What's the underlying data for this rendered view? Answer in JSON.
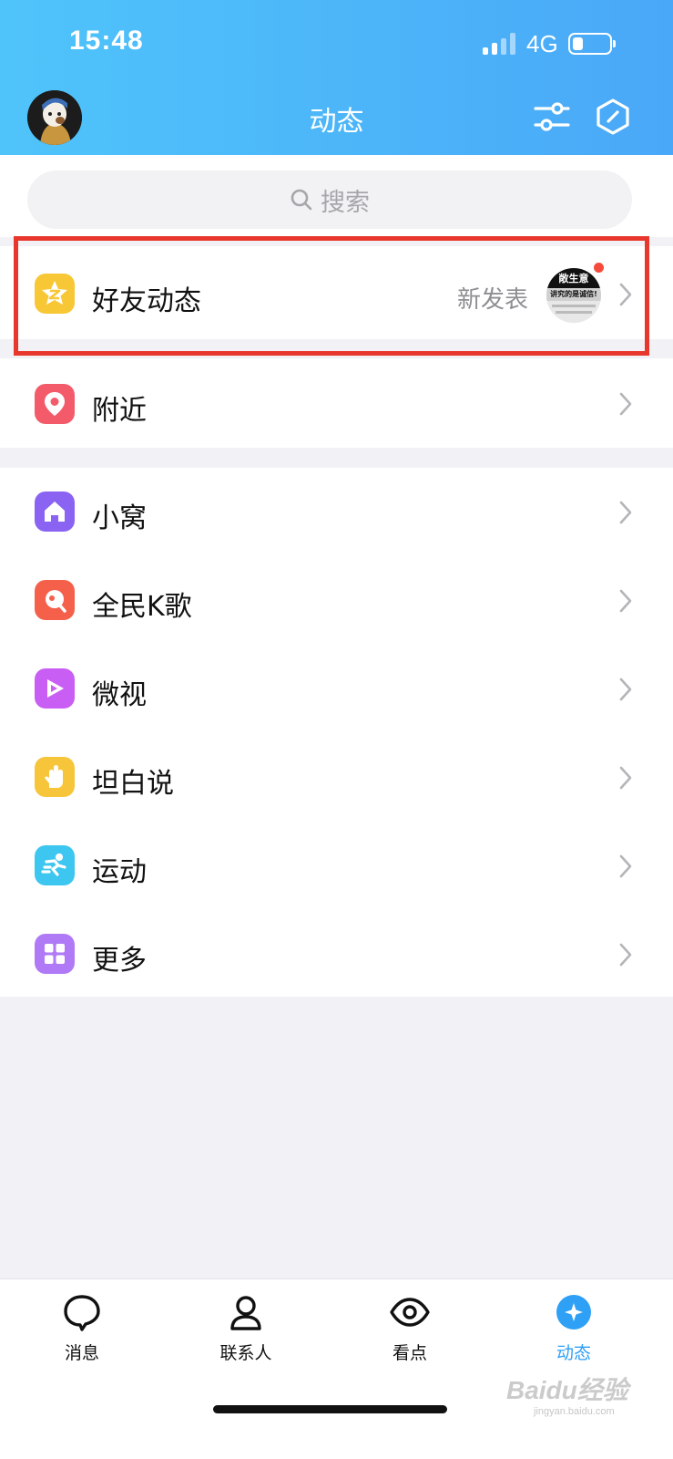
{
  "status": {
    "time": "15:48",
    "network": "4G",
    "battery_level": 0.3
  },
  "header": {
    "title": "动态"
  },
  "search": {
    "placeholder": "搜索"
  },
  "friends": {
    "label": "好友动态",
    "subtitle": "新发表",
    "thumb_text": "敞生意",
    "thumb_subtext": "讲究的是诚信!"
  },
  "menu": [
    {
      "label": "附近",
      "icon": "location-pin-icon",
      "color": "#f35b6b"
    },
    {
      "label": "小窝",
      "icon": "house-icon",
      "color": "#8a63f2"
    },
    {
      "label": "全民K歌",
      "icon": "karaoke-icon",
      "color": "#f5604b"
    },
    {
      "label": "微视",
      "icon": "play-icon",
      "color": "#c95ef4"
    },
    {
      "label": "坦白说",
      "icon": "hand-icon",
      "color": "#f7c53a"
    },
    {
      "label": "运动",
      "icon": "running-icon",
      "color": "#3cc6f0"
    },
    {
      "label": "更多",
      "icon": "grid-icon",
      "color": "#b07af7"
    }
  ],
  "tabs": [
    {
      "label": "消息",
      "icon": "chat-bubble-icon"
    },
    {
      "label": "联系人",
      "icon": "person-icon"
    },
    {
      "label": "看点",
      "icon": "eye-icon"
    },
    {
      "label": "动态",
      "icon": "star-planet-icon",
      "active": true
    }
  ],
  "watermark": {
    "text": "Baidu经验",
    "sub": "jingyan.baidu.com"
  }
}
